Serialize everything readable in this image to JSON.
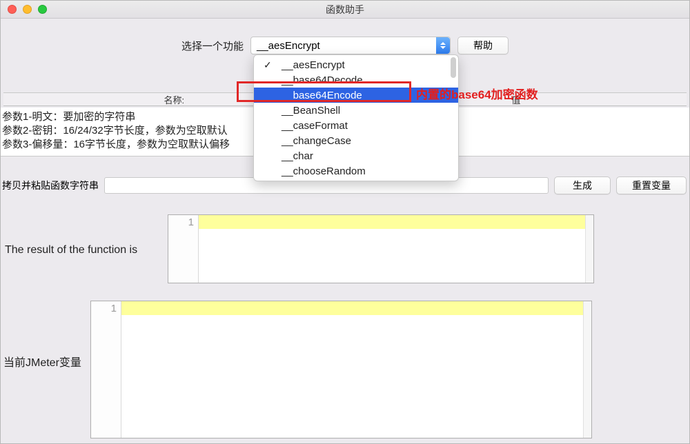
{
  "window": {
    "title": "函数助手"
  },
  "selectRow": {
    "label": "选择一个功能",
    "selected": "__aesEncrypt",
    "helpBtn": "帮助"
  },
  "dropdown": {
    "items": [
      {
        "label": "__aesEncrypt",
        "checked": true,
        "selected": false
      },
      {
        "label": "__base64Decode",
        "checked": false,
        "selected": false
      },
      {
        "label": "__base64Encode",
        "checked": false,
        "selected": true
      },
      {
        "label": "__BeanShell",
        "checked": false,
        "selected": false
      },
      {
        "label": "__caseFormat",
        "checked": false,
        "selected": false
      },
      {
        "label": "__changeCase",
        "checked": false,
        "selected": false
      },
      {
        "label": "__char",
        "checked": false,
        "selected": false
      },
      {
        "label": "__chooseRandom",
        "checked": false,
        "selected": false
      }
    ]
  },
  "annotation": "内置的base64加密函数",
  "columns": {
    "name": "名称:",
    "value": "值"
  },
  "params": {
    "p1": "参数1-明文：要加密的字符串",
    "p2": "参数2-密钥：16/24/32字节长度，参数为空取默认",
    "p3": "参数3-偏移量：16字节长度，参数为空取默认偏移"
  },
  "copyRow": {
    "label": "拷贝并粘贴函数字符串",
    "generate": "生成",
    "reset": "重置变量"
  },
  "resultLabel": "The result of the function is",
  "varsLabel": "当前JMeter变量",
  "lineNum": "1"
}
